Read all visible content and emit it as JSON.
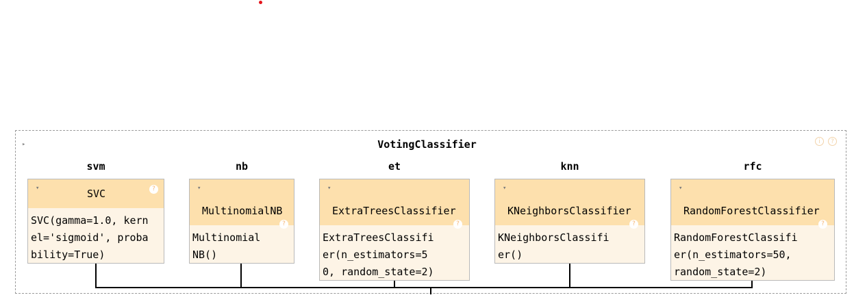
{
  "voting": {
    "title": "VotingClassifier",
    "info_icon": "i",
    "help_icon": "?"
  },
  "estimators": [
    {
      "name": "svm",
      "class_name": "SVC",
      "params_lines": [
        "SVC(gamma=1.0, kern",
        "el='sigmoid', proba",
        "bility=True)"
      ]
    },
    {
      "name": "nb",
      "class_name": "MultinomialNB",
      "params_lines": [
        "Multinomial",
        "NB()"
      ]
    },
    {
      "name": "et",
      "class_name": "ExtraTreesClassifier",
      "params_lines": [
        "ExtraTreesClassifi",
        "er(n_estimators=5",
        "0, random_state=2)"
      ]
    },
    {
      "name": "knn",
      "class_name": "KNeighborsClassifier",
      "params_lines": [
        "KNeighborsClassifi",
        "er()"
      ]
    },
    {
      "name": "rfc",
      "class_name": "RandomForestClassifier",
      "params_lines": [
        "RandomForestClassifi",
        "er(n_estimators=50,",
        "random_state=2)"
      ]
    }
  ],
  "icons": {
    "toggle": "▸",
    "expand": "▾",
    "help": "?"
  },
  "colors": {
    "header_bg": "#fde0ad",
    "body_bg": "#fdf4e6",
    "border": "#b9b9b9",
    "dashed_border": "#9a9a9a",
    "accent_dot": "#e4141b"
  }
}
